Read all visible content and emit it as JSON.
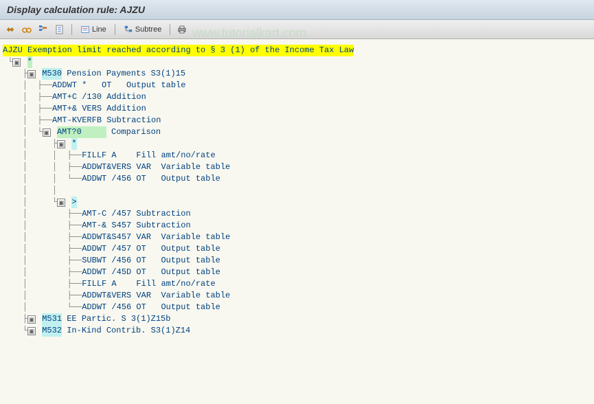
{
  "title": "Display calculation rule: AJZU",
  "toolbar": {
    "line_label": "Line",
    "subtree_label": "Subtree"
  },
  "watermark": "www.tutorialkart.com",
  "tree": {
    "root": {
      "code": "AJZU",
      "text": " Exemption limit reached according to § 3 (1) of the Income Tax Law"
    },
    "star": "*",
    "m530": {
      "code": "M530",
      "text": " Pension Payments S3(1)15"
    },
    "l1": "ADDWT *   OT   Output table",
    "l2": "AMT+C /130 Addition",
    "l3": "AMT+& VERS Addition",
    "l4": "AMT-KVERFB Subtraction",
    "amt0": {
      "code": "AMT?0     ",
      "text": " Comparison"
    },
    "star2": "*",
    "l5": "FILLF A    Fill amt/no/rate",
    "l6": "ADDWT&VERS VAR  Variable table",
    "l7": "ADDWT /456 OT   Output table",
    "gt": ">",
    "l8": "AMT-C /457 Subtraction",
    "l9": "AMT-& S457 Subtraction",
    "l10": "ADDWT&S457 VAR  Variable table",
    "l11": "ADDWT /457 OT   Output table",
    "l12": "SUBWT /456 OT   Output table",
    "l13": "ADDWT /45D OT   Output table",
    "l14": "FILLF A    Fill amt/no/rate",
    "l15": "ADDWT&VERS VAR  Variable table",
    "l16": "ADDWT /456 OT   Output table",
    "m531": {
      "code": "M531",
      "text": " EE Partic. S 3(1)Z15b"
    },
    "m532": {
      "code": "M532",
      "text": " In-Kind Contrib. S3(1)Z14"
    }
  }
}
